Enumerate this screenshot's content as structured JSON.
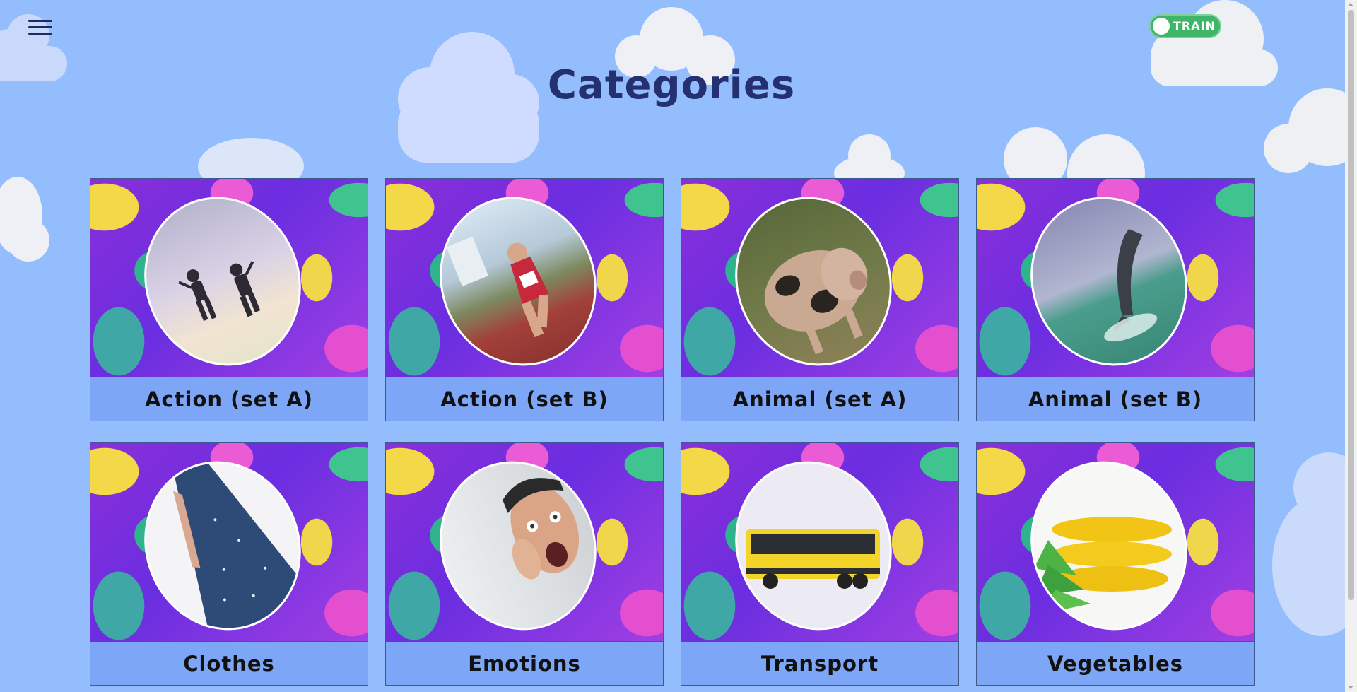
{
  "header": {
    "menu_icon": "hamburger-menu-icon",
    "mode_toggle_label": "TRAIN",
    "mode_toggle_on": true,
    "mode_toggle_color": "#3fb56a"
  },
  "page": {
    "title": "Categories"
  },
  "categories": [
    {
      "label": "Action (set A)",
      "image": "kids-jumping-in-sky"
    },
    {
      "label": "Action (set B)",
      "image": "girl-running-on-track"
    },
    {
      "label": "Animal (set A)",
      "image": "spotted-pig"
    },
    {
      "label": "Animal (set B)",
      "image": "dolphin-jumping"
    },
    {
      "label": "Clothes",
      "image": "blue-skirt"
    },
    {
      "label": "Emotions",
      "image": "surprised-man"
    },
    {
      "label": "Transport",
      "image": "yellow-bus"
    },
    {
      "label": "Vegetables",
      "image": "corn-cobs"
    }
  ],
  "colors": {
    "background": "#93bdfc",
    "title": "#253070",
    "card_label_bg": "#7ea6f6"
  }
}
